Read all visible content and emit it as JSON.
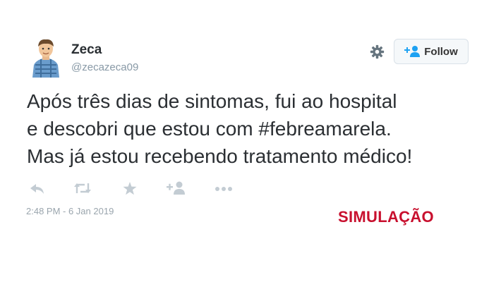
{
  "author": {
    "name": "Zeca",
    "handle": "@zecazeca09"
  },
  "follow_button": {
    "label": "Follow",
    "icon": "follow-person-plus-icon"
  },
  "settings_icon": "gear-icon",
  "tweet": {
    "lines": [
      "Após três dias de sintomas, fui ao hospital",
      "e descobri que estou com #febreamarela.",
      "Mas já estou recebendo tratamento médico!"
    ],
    "timestamp": "2:48 PM - 6 Jan 2019"
  },
  "actions": [
    "reply-icon",
    "retweet-icon",
    "favorite-star-icon",
    "follow-icon",
    "more-icon"
  ],
  "watermark": "SIMULAÇÃO",
  "colors": {
    "action_icon": "#c3ccd3",
    "handle": "#8899a6",
    "watermark": "#c8102e"
  }
}
